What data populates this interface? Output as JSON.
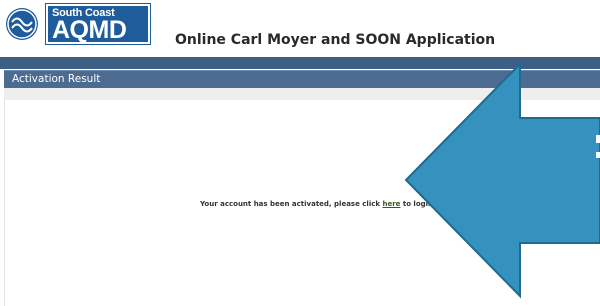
{
  "logo": {
    "line1": "South Coast",
    "line2": "AQMD"
  },
  "header": {
    "title": "Online Carl Moyer and SOON Application"
  },
  "panel": {
    "title": "Activation Result"
  },
  "message": {
    "before": "Your account has been activated, please click ",
    "link": "here",
    "after": " to login."
  },
  "colors": {
    "accent": "#4b6b90",
    "arrow": "#3591bd",
    "arrow_outline": "#1f6a8f",
    "brand": "#1f5c9c"
  },
  "icons": {
    "emblem": "aqmd-emblem-icon",
    "annotation": "arrow-pointer-icon"
  }
}
